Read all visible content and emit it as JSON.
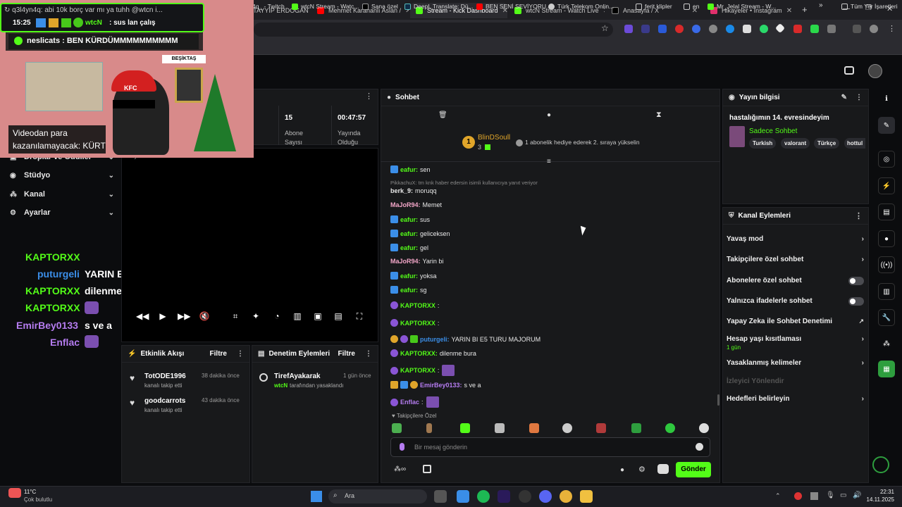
{
  "browser": {
    "tabs": [
      {
        "label": "q3l4yn4q: abi 10k borç var mı ya tuhh @wtcn i...",
        "active": false,
        "color": "#53fc18"
      },
      {
        "label": "RECEP TAYYİP ERDOĞAN",
        "active": false,
        "color": "#ff0000"
      },
      {
        "label": "Mehmet Karahanlı Aslan /",
        "active": false,
        "color": "#ff0000"
      },
      {
        "label": "Stream - Kick Dashboard",
        "active": true,
        "color": "#53fc18"
      },
      {
        "label": "wtcN Stream - Watch Live",
        "active": false,
        "color": "#53fc18"
      },
      {
        "label": "Anasayfa / X",
        "active": false,
        "color": "#dddddd"
      },
      {
        "label": "Hikayeler • Instagram",
        "active": false,
        "color": "#e1306c"
      }
    ],
    "new_tab": "+",
    "bookmarks": [
      {
        "label": "4q_ - Twitch",
        "color": "#9146ff"
      },
      {
        "label": "wtcN Stream - Watc...",
        "color": "#53fc18"
      },
      {
        "label": "Sana özel",
        "color": "#dddddd"
      },
      {
        "label": "DeepL Translate: Dü...",
        "color": "#0f2b46"
      },
      {
        "label": "BEN SENİ SEVİYORU...",
        "color": "#ff0000"
      },
      {
        "label": "Türk Telekom Onlin...",
        "color": "#cccccc"
      },
      {
        "label": "ferit klipler",
        "color": "#cccccc"
      },
      {
        "label": "en",
        "color": "#cccccc"
      },
      {
        "label": "Mr_Jelal Stream - W...",
        "color": "#53fc18"
      }
    ],
    "bookmarks_more": "»",
    "all_bookmarks": "Tüm Yer İşaretleri"
  },
  "overlay": {
    "top_chat": "q3l4yn4q: abi 10k borç var mı ya tuhh @wtcn i...",
    "time": "15:25",
    "chat_user": "wtcN",
    "chat_text": "sus lan çalış",
    "donation": "neslicats : BEN KÜRDÜMMMMMMMMMM",
    "cam_banner": "BEŞİKTAŞ",
    "video_caption_1": "Videodan para",
    "video_caption_2": "kazanılamayacak: KÜRT",
    "hat_text": "KFC"
  },
  "nav": [
    {
      "label": "Droplar ve Ödüller",
      "icon": "gift-icon"
    },
    {
      "label": "Stüdyo",
      "icon": "studio-icon"
    },
    {
      "label": "Kanal",
      "icon": "channel-icon"
    },
    {
      "label": "Ayarlar",
      "icon": "gear-icon"
    }
  ],
  "stream_chat_overlay": [
    {
      "user": "KAPTORXX",
      "text": "",
      "color": "#53fc18"
    },
    {
      "user": "puturgeli",
      "text": "YARIN BI E5 TURU MAJORUM",
      "color": "#3b8ee8"
    },
    {
      "user": "KAPTORXX",
      "text": "dilenme bura",
      "color": "#53fc18"
    },
    {
      "user": "KAPTORXX",
      "text": "",
      "color": "#53fc18"
    },
    {
      "user": "EmirBey0133",
      "text": "s ve a",
      "color": "#b57cf0"
    },
    {
      "user": "Enflac",
      "text": "",
      "color": "#b57cf0"
    }
  ],
  "stats": {
    "subs_value": "15",
    "subs_label_1": "Abone",
    "subs_label_2": "Sayısı",
    "uptime_value": "00:47:57",
    "uptime_label_1": "Yayında",
    "uptime_label_2": "Olduğu"
  },
  "video_header": "Yayın Önizlemesi",
  "activity": {
    "title": "Etkinlik Akışı",
    "filter": "Filtre",
    "items": [
      {
        "user": "TotODE1996",
        "desc": "kanalı takip etti",
        "time": "38 dakika önce"
      },
      {
        "user": "goodcarrots",
        "desc": "kanalı takip etti",
        "time": "43 dakika önce"
      }
    ]
  },
  "moderation": {
    "title": "Denetim Eylemleri",
    "filter": "Filtre",
    "items": [
      {
        "user": "TirefAyakarak",
        "by": "wtcN",
        "desc": "tarafından yasaklandı",
        "time": "1 gün önce"
      }
    ]
  },
  "chat": {
    "title": "Sohbet",
    "pinned_user": "BlinDSoull",
    "pinned_count": "3",
    "pinned_text": "1 abonelik hediye ederek 2. sıraya yükselin",
    "reply_ref": "PikkachuX: tm knk haber edersin isimli kullanıcıya yanıt veriyor",
    "messages": [
      {
        "user": "eafur",
        "text": "sen",
        "color": "#53fc18",
        "badge": "blue"
      },
      {
        "user": "berk_9",
        "text": "moruqq",
        "color": "#e8e8e8",
        "badge": ""
      },
      {
        "user": "MaJoR94",
        "text": "Memet",
        "color": "#f3a6c8",
        "badge": ""
      },
      {
        "user": "eafur",
        "text": "sus",
        "color": "#53fc18",
        "badge": "blue"
      },
      {
        "user": "eafur",
        "text": "geliceksen",
        "color": "#53fc18",
        "badge": "blue"
      },
      {
        "user": "eafur",
        "text": "gel",
        "color": "#53fc18",
        "badge": "blue"
      },
      {
        "user": "MaJoR94",
        "text": "Yarin bi",
        "color": "#f3a6c8",
        "badge": ""
      },
      {
        "user": "eafur",
        "text": "yoksa",
        "color": "#53fc18",
        "badge": "blue"
      },
      {
        "user": "eafur",
        "text": "sg",
        "color": "#53fc18",
        "badge": "blue"
      },
      {
        "user": "KAPTORXX",
        "text": "",
        "color": "#53fc18",
        "badge": "purple"
      },
      {
        "user": "KAPTORXX",
        "text": "",
        "color": "#53fc18",
        "badge": "purple"
      },
      {
        "user": "puturgeli",
        "text": "YARIN BI E5 TURU MAJORUM",
        "color": "#3b8ee8",
        "badge": "gold"
      },
      {
        "user": "KAPTORXX",
        "text": "dilenme bura",
        "color": "#53fc18",
        "badge": "purple"
      },
      {
        "user": "KAPTORXX",
        "text": "",
        "color": "#53fc18",
        "badge": "purple"
      },
      {
        "user": "EmirBey0133",
        "text": "s ve a",
        "color": "#b57cf0",
        "badge": "gold"
      },
      {
        "user": "Enflac",
        "text": "",
        "color": "#b57cf0",
        "badge": "purple"
      }
    ],
    "followers_only": "Takipçilere Özel",
    "input_placeholder": "Bir mesaj gönderin",
    "send": "Gönder"
  },
  "stream_info": {
    "title": "Yayın bilgisi",
    "stream_title": "hastalığımın 14. evresindeyim",
    "category": "Sadece Sohbet",
    "tags": [
      "Turkish",
      "valorant",
      "Türkçe",
      "hottul"
    ]
  },
  "channel_actions": {
    "title": "Kanal Eylemleri",
    "items": [
      {
        "label": "Yavaş mod",
        "type": "chevron"
      },
      {
        "label": "Takipçilere özel sohbet",
        "type": "chevron"
      },
      {
        "label": "Abonelere özel sohbet",
        "type": "toggle"
      },
      {
        "label": "Yalnızca ifadelerle sohbet",
        "type": "toggle"
      },
      {
        "label": "Yapay Zeka ile Sohbet Denetimi",
        "type": "external"
      },
      {
        "label": "Hesap yaşı kısıtlaması",
        "type": "chevron",
        "sub": "1 gün"
      },
      {
        "label": "Yasaklanmış kelimeler",
        "type": "chevron"
      },
      {
        "label": "İzleyici Yönlendir",
        "type": "disabled"
      },
      {
        "label": "Hedefleri belirleyin",
        "type": "chevron"
      }
    ]
  },
  "taskbar": {
    "temp": "11°C",
    "weather": "Çok bulutlu",
    "search": "Ara",
    "time": "22:31",
    "date": "14.11.2025"
  },
  "colors": {
    "kick_green": "#53fc18",
    "panel": "#18191b",
    "bg": "#0b0c0e"
  }
}
